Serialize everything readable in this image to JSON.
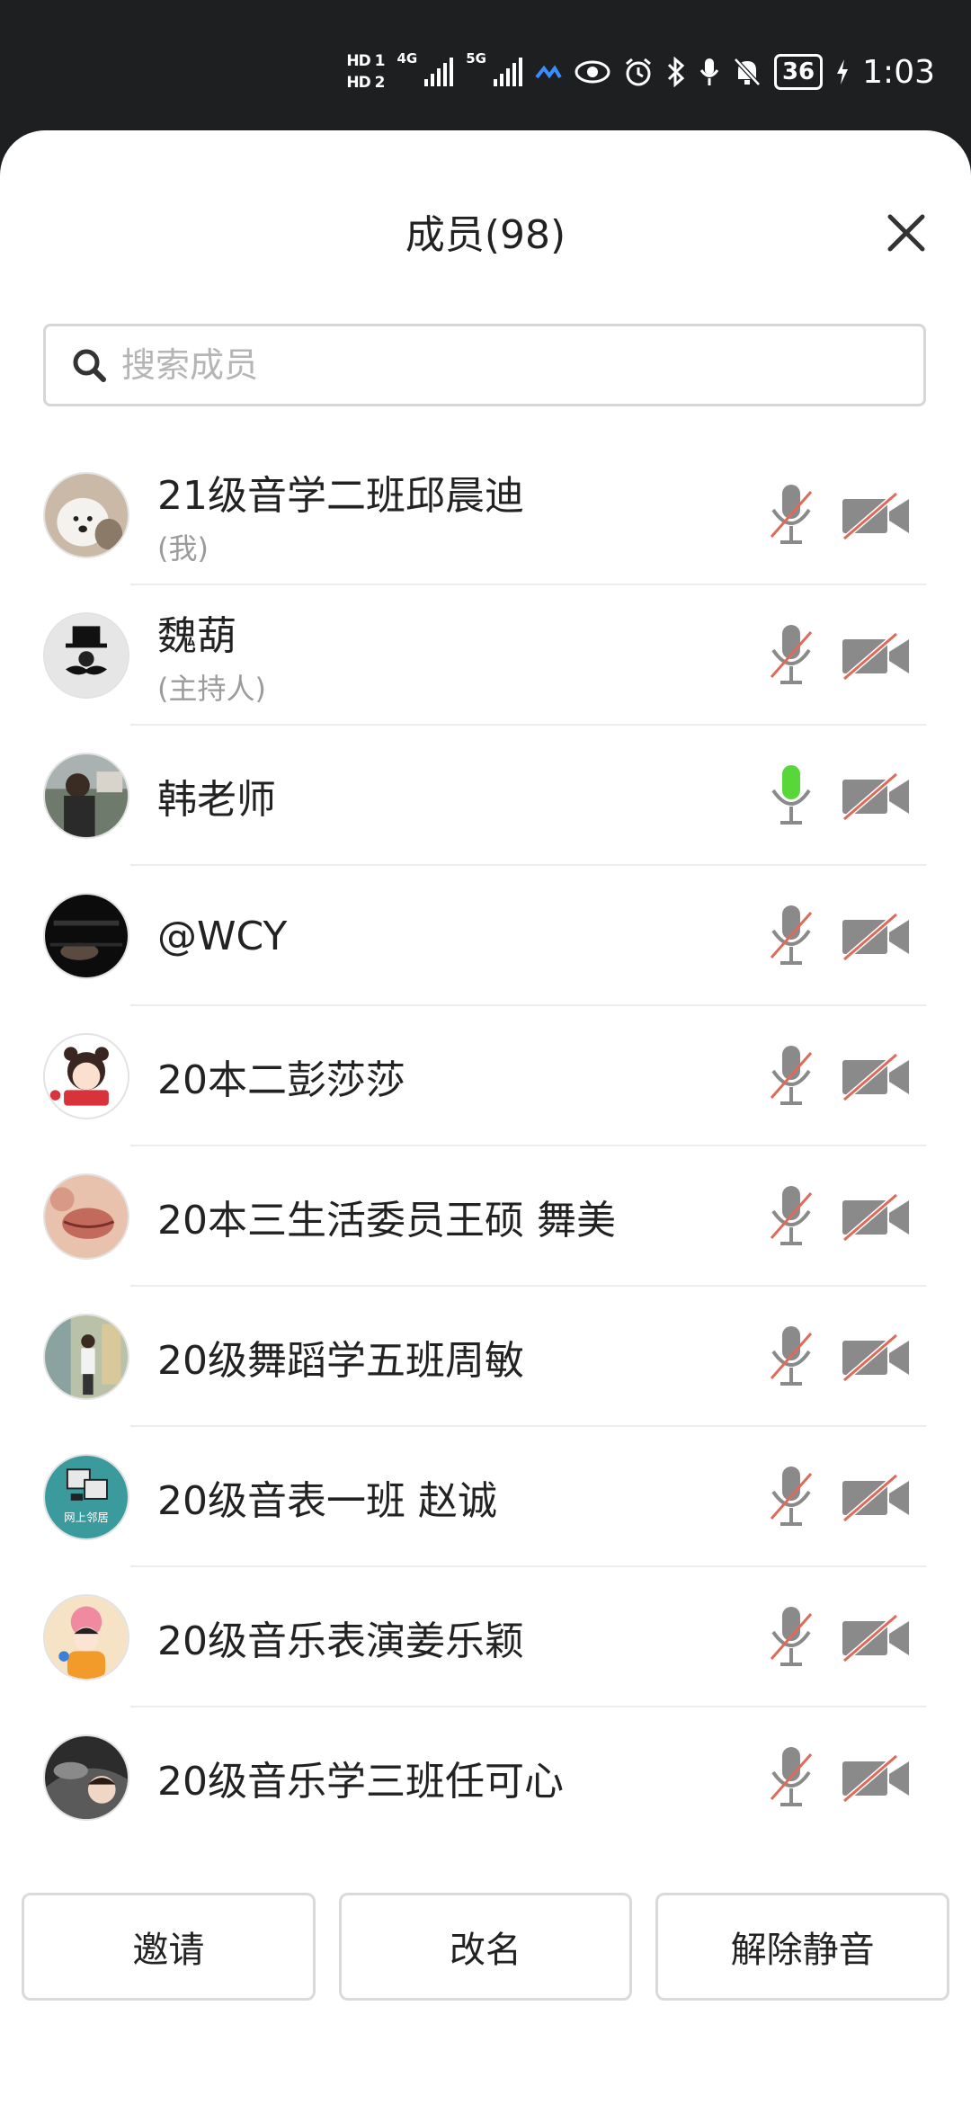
{
  "status_bar": {
    "hd1": "HD 1",
    "hd2": "HD 2",
    "net1": "4G",
    "net2": "5G",
    "battery": "36",
    "time": "1:03",
    "icons": [
      "eye-icon",
      "alarm-icon",
      "bluetooth-icon",
      "mic-icon",
      "bell-off-icon",
      "charging-icon"
    ]
  },
  "header": {
    "title": "成员(98)",
    "close_icon": "close-icon"
  },
  "search": {
    "placeholder": "搜索成员",
    "value": ""
  },
  "members": [
    {
      "name": "21级音学二班邱晨迪",
      "sub": "(我)",
      "mic": "muted",
      "camera": "off"
    },
    {
      "name": "魏葫",
      "sub": "(主持人)",
      "mic": "muted",
      "camera": "off"
    },
    {
      "name": "韩老师",
      "sub": "",
      "mic": "speaking",
      "camera": "off"
    },
    {
      "name": "@WCY",
      "sub": "",
      "mic": "muted",
      "camera": "off"
    },
    {
      "name": "20本二彭莎莎",
      "sub": "",
      "mic": "muted",
      "camera": "off"
    },
    {
      "name": "20本三生活委员王硕 舞美",
      "sub": "",
      "mic": "muted",
      "camera": "off"
    },
    {
      "name": "20级舞蹈学五班周敏",
      "sub": "",
      "mic": "muted",
      "camera": "off"
    },
    {
      "name": "20级音表一班 赵诚",
      "sub": "",
      "mic": "muted",
      "camera": "off"
    },
    {
      "name": "20级音乐表演姜乐颖",
      "sub": "",
      "mic": "muted",
      "camera": "off"
    },
    {
      "name": "20级音乐学三班任可心",
      "sub": "",
      "mic": "muted",
      "camera": "off"
    }
  ],
  "avatar_texts": {
    "m7": "网上邻居"
  },
  "actions": {
    "invite": "邀请",
    "rename": "改名",
    "unmute": "解除静音"
  },
  "colors": {
    "mute_slash": "#e06a5a",
    "speaking": "#58d63a",
    "icon_gray": "#8a8a8a"
  }
}
